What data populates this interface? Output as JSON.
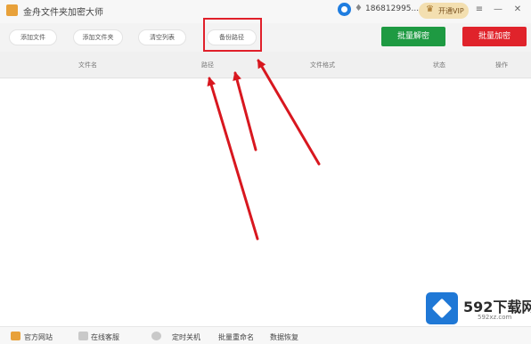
{
  "titlebar": {
    "title": "金舟文件夹加密大师",
    "phone": "1868129​95...",
    "vip_label": "开通VIP"
  },
  "toolbar": {
    "add_files": "添加文件",
    "add_folder": "添加文件夹",
    "clear_list": "清空列表",
    "backup_path": "备份路径",
    "batch_decrypt": "批量解密",
    "batch_encrypt": "批量加密"
  },
  "table": {
    "columns": [
      "文件名",
      "路径",
      "文件格式",
      "状态",
      "操作"
    ]
  },
  "statusbar": {
    "website": "官方网站",
    "online_service": "在线客服",
    "scheduled_shutdown": "定时关机",
    "batch_rename": "批量重命名",
    "data_recovery": "数据恢复"
  },
  "watermark": {
    "brand": "592下载网",
    "domain": "592xz.com"
  },
  "colors": {
    "decrypt": "#1e9a42",
    "encrypt": "#e0232b",
    "highlight": "#e0202a",
    "arrow": "#d8171f"
  }
}
